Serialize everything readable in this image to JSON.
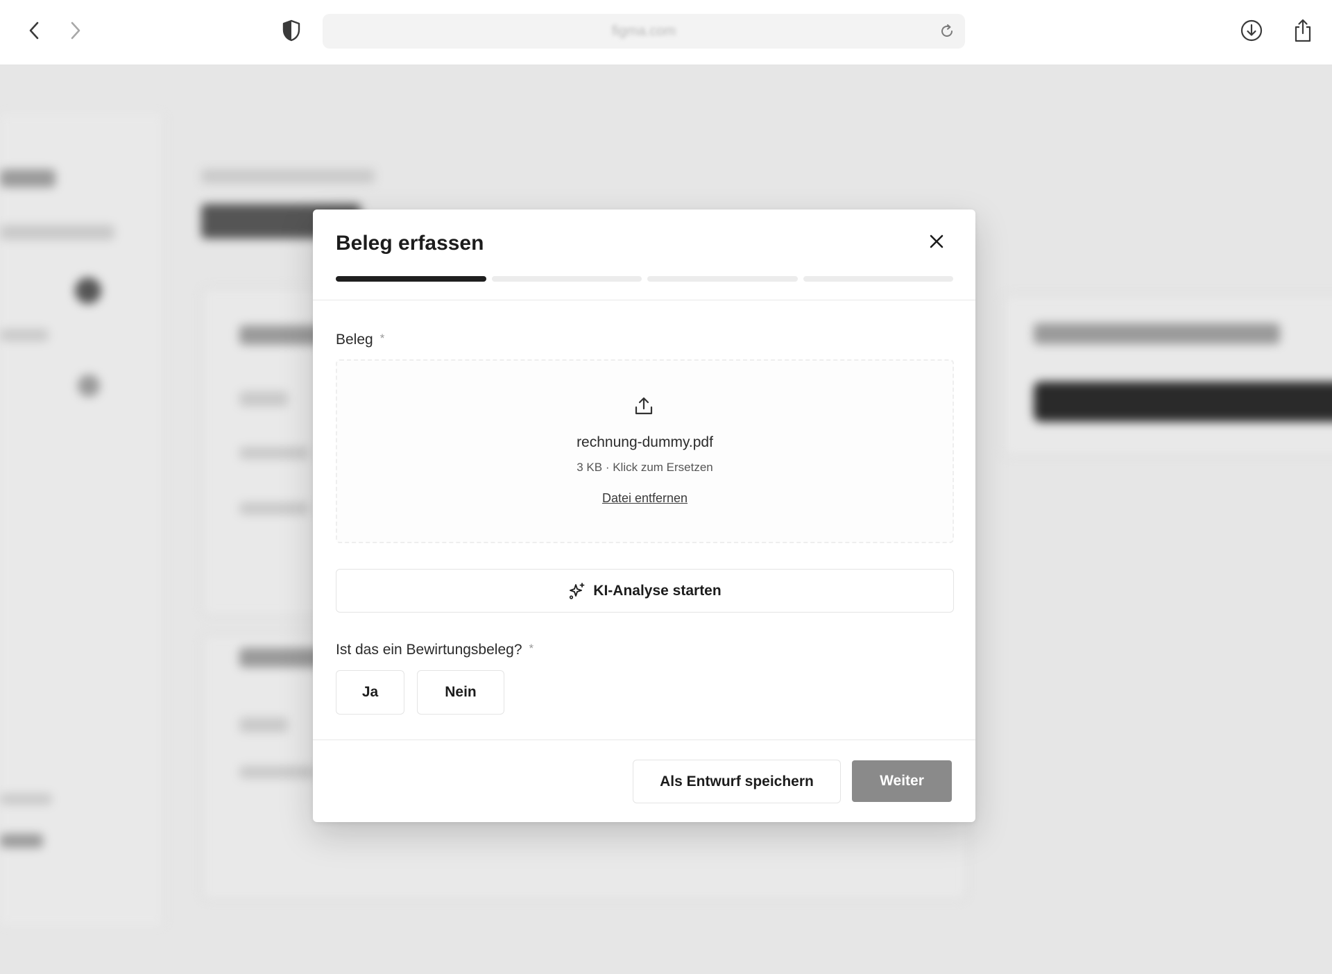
{
  "browser": {
    "address_text": "figma.com",
    "icons": {
      "back": "chevron-left-icon",
      "forward": "chevron-right-icon",
      "privacy": "shield-icon",
      "reload": "reload-icon",
      "download": "download-icon",
      "share": "share-icon"
    }
  },
  "modal": {
    "title": "Beleg erfassen",
    "steps_total": 4,
    "current_step": 1,
    "receipt_field": {
      "label": "Beleg",
      "required_mark": "*"
    },
    "upload": {
      "file_name": "rechnung-dummy.pdf",
      "file_meta": "3 KB · Klick zum Ersetzen",
      "remove_label": "Datei entfernen"
    },
    "ai_button_label": "KI-Analyse starten",
    "hospitality_question": {
      "label": "Ist das ein Bewirtungsbeleg?",
      "required_mark": "*",
      "yes_label": "Ja",
      "no_label": "Nein"
    },
    "footer": {
      "draft_label": "Als Entwurf speichern",
      "next_label": "Weiter"
    }
  },
  "colors": {
    "overlay_background": "#e6e6e6",
    "step_active": "#1f1f1f",
    "step_inactive": "#ececec",
    "primary_disabled": "#8a8a8a"
  }
}
